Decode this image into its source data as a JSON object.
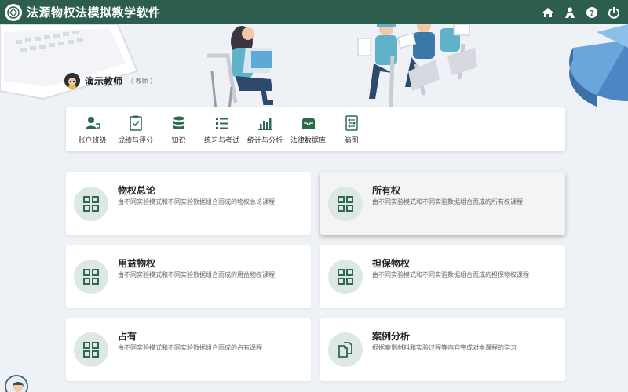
{
  "app": {
    "title": "法源物权法模拟教学软件"
  },
  "titlebar": {
    "icons": [
      "home-icon",
      "user-icon",
      "help-icon",
      "power-icon"
    ]
  },
  "teacher": {
    "name": "演示教师",
    "role": "（ 教师 ）"
  },
  "toolbar": {
    "items": [
      {
        "label": "账户班级",
        "icon": "account-class-icon"
      },
      {
        "label": "成绩与评分",
        "icon": "grade-clipboard-icon"
      },
      {
        "label": "知识",
        "icon": "database-icon"
      },
      {
        "label": "练习与考试",
        "icon": "list-icon"
      },
      {
        "label": "统计与分析",
        "icon": "bar-chart-icon"
      },
      {
        "label": "法律数据库",
        "icon": "inbox-icon"
      },
      {
        "label": "脑图",
        "icon": "mindmap-icon"
      }
    ]
  },
  "courses": [
    {
      "title": "物权总论",
      "desc": "由不同实验模式和不同实验数据组合而成的物权总论课程",
      "icon": "grid-icon"
    },
    {
      "title": "所有权",
      "desc": "由不同实验模式和不同实验数据组合而成的所有权课程",
      "icon": "grid-icon"
    },
    {
      "title": "用益物权",
      "desc": "由不同实验模式和不同实验数据组合而成的用益物权课程",
      "icon": "grid-icon"
    },
    {
      "title": "担保物权",
      "desc": "由不同实验模式和不同实验数据组合而成的担保物权课程",
      "icon": "grid-icon"
    },
    {
      "title": "占有",
      "desc": "由不同实验模式和不同实验数据组合而成的占有课程",
      "icon": "grid-icon"
    },
    {
      "title": "案例分析",
      "desc": "根据案例材料和实验过程等内容完成对本课程的学习",
      "icon": "copy-files-icon"
    }
  ],
  "colors": {
    "titlebar": "#2d5d4f",
    "accent": "#2e6b4d",
    "icon_bg": "#dde8e5"
  }
}
